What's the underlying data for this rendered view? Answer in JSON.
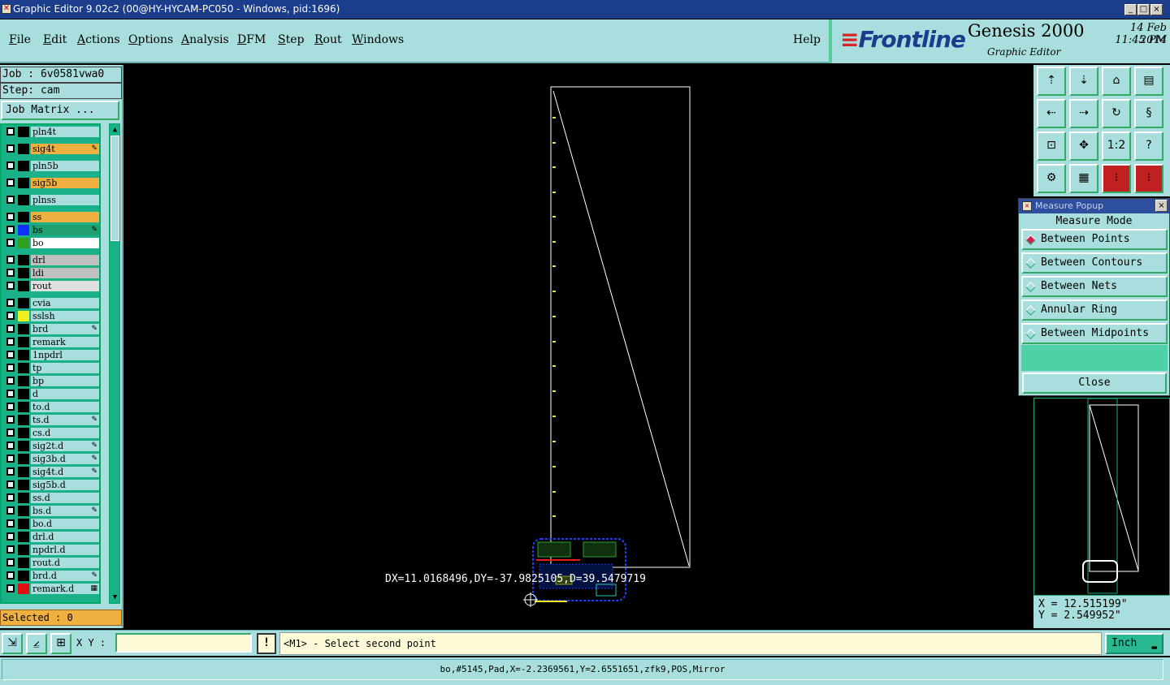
{
  "window": {
    "title": "Graphic Editor 9.02c2 (00@HY-HYCAM-PC050 - Windows, pid:1696)",
    "minimize": "_",
    "maximize": "□",
    "close": "×"
  },
  "menu": [
    {
      "label": "File",
      "ul": "F",
      "rest": "ile"
    },
    {
      "label": "Edit",
      "ul": "E",
      "rest": "dit"
    },
    {
      "label": "Actions",
      "ul": "A",
      "rest": "ctions"
    },
    {
      "label": "Options",
      "ul": "O",
      "rest": "ptions"
    },
    {
      "label": "Analysis",
      "ul": "A",
      "rest": "nalysis"
    },
    {
      "label": "DFM",
      "ul": "D",
      "rest": "FM"
    },
    {
      "label": "Step",
      "ul": "S",
      "rest": "tep"
    },
    {
      "label": "Rout",
      "ul": "R",
      "rest": "out"
    },
    {
      "label": "Windows",
      "ul": "W",
      "rest": "indows"
    },
    {
      "label": "Help",
      "ul": "",
      "rest": "Help"
    }
  ],
  "brand": {
    "logo": "Frontline",
    "product": "Genesis 2000",
    "subtitle": "Graphic Editor",
    "date": "14 Feb 2014",
    "time": "11:45 PM"
  },
  "left": {
    "job": "Job : 6v0581vwa0",
    "step": "Step: cam",
    "job_matrix": "Job Matrix ...",
    "selected": "Selected : 0"
  },
  "layers": [
    {
      "name": "pln4t",
      "swatch": "",
      "bg": "#a8dede",
      "mark": ""
    },
    {
      "name": "sig4t",
      "swatch": "",
      "bg": "#f0b040",
      "mark": "✎"
    },
    {
      "name": "pln5b",
      "swatch": "",
      "bg": "#a8dede",
      "mark": ""
    },
    {
      "name": "sig5b",
      "swatch": "",
      "bg": "#f0b040",
      "mark": ""
    },
    {
      "name": "plnss",
      "swatch": "",
      "bg": "#a8dede",
      "mark": ""
    },
    {
      "name": "ss",
      "swatch": "",
      "bg": "#f0b040",
      "mark": ""
    },
    {
      "name": "bs",
      "swatch": "#1030ff",
      "bg": "#20a070",
      "mark": "✎"
    },
    {
      "name": "bo",
      "swatch": "#30a020",
      "bg": "#ffffff",
      "mark": ""
    },
    {
      "name": "drl",
      "swatch": "",
      "bg": "#c0c0c0",
      "mark": ""
    },
    {
      "name": "ldi",
      "swatch": "",
      "bg": "#c0c0c0",
      "mark": ""
    },
    {
      "name": "rout",
      "swatch": "",
      "bg": "#e0e0e0",
      "mark": ""
    },
    {
      "name": "cvia",
      "swatch": "",
      "bg": "#a8dede",
      "mark": ""
    },
    {
      "name": "sslsh",
      "swatch": "#f0f020",
      "bg": "#a8dede",
      "mark": ""
    },
    {
      "name": "brd",
      "swatch": "",
      "bg": "#a8dede",
      "mark": "✎"
    },
    {
      "name": "remark",
      "swatch": "",
      "bg": "#a8dede",
      "mark": ""
    },
    {
      "name": "1npdrl",
      "swatch": "",
      "bg": "#a8dede",
      "mark": ""
    },
    {
      "name": "tp",
      "swatch": "",
      "bg": "#a8dede",
      "mark": ""
    },
    {
      "name": "bp",
      "swatch": "",
      "bg": "#a8dede",
      "mark": ""
    },
    {
      "name": "d",
      "swatch": "",
      "bg": "#a8dede",
      "mark": ""
    },
    {
      "name": "to.d",
      "swatch": "",
      "bg": "#a8dede",
      "mark": ""
    },
    {
      "name": "ts.d",
      "swatch": "",
      "bg": "#a8dede",
      "mark": "✎"
    },
    {
      "name": "cs.d",
      "swatch": "",
      "bg": "#a8dede",
      "mark": ""
    },
    {
      "name": "sig2t.d",
      "swatch": "",
      "bg": "#a8dede",
      "mark": "✎"
    },
    {
      "name": "sig3b.d",
      "swatch": "",
      "bg": "#a8dede",
      "mark": "✎"
    },
    {
      "name": "sig4t.d",
      "swatch": "",
      "bg": "#a8dede",
      "mark": "✎"
    },
    {
      "name": "sig5b.d",
      "swatch": "",
      "bg": "#a8dede",
      "mark": ""
    },
    {
      "name": "ss.d",
      "swatch": "",
      "bg": "#a8dede",
      "mark": ""
    },
    {
      "name": "bs.d",
      "swatch": "",
      "bg": "#a8dede",
      "mark": "✎"
    },
    {
      "name": "bo.d",
      "swatch": "",
      "bg": "#a8dede",
      "mark": ""
    },
    {
      "name": "drl.d",
      "swatch": "",
      "bg": "#a8dede",
      "mark": ""
    },
    {
      "name": "npdrl.d",
      "swatch": "",
      "bg": "#a8dede",
      "mark": ""
    },
    {
      "name": "rout.d",
      "swatch": "",
      "bg": "#a8dede",
      "mark": ""
    },
    {
      "name": "brd.d",
      "swatch": "",
      "bg": "#a8dede",
      "mark": "✎"
    },
    {
      "name": "remark.d",
      "swatch": "#e01010",
      "bg": "#a8dede",
      "mark": "▦"
    }
  ],
  "canvas": {
    "readout": "DX=11.0168496,DY=-37.9825105,D=39.5479719"
  },
  "tools": {
    "one_to_two": "1:2",
    "help": "?"
  },
  "measure_popup": {
    "title": "Measure Popup",
    "mode_label": "Measure Mode",
    "options": [
      {
        "label": "Between Points",
        "selected": true
      },
      {
        "label": "Between Contours",
        "selected": false
      },
      {
        "label": "Between Nets",
        "selected": false
      },
      {
        "label": "Annular Ring",
        "selected": false
      },
      {
        "label": "Between Midpoints",
        "selected": false
      }
    ],
    "close": "Close"
  },
  "coords": {
    "x": "X = 12.515199\"",
    "y": "Y = 2.549952\""
  },
  "cmd": {
    "xy_label": "X Y :",
    "xy_value": "",
    "excl": "!",
    "prompt": "<M1> - Select second point",
    "unit": "Inch",
    "unit_dd": "▬"
  },
  "status": "bo,#5145,Pad,X=-2.2369561,Y=2.6551651,zfk9,POS,Mirror",
  "colors": {
    "panel": "#a8dede",
    "accent_green": "#1ab088",
    "orange": "#f0b040",
    "title_blue": "#1b3d8c"
  }
}
